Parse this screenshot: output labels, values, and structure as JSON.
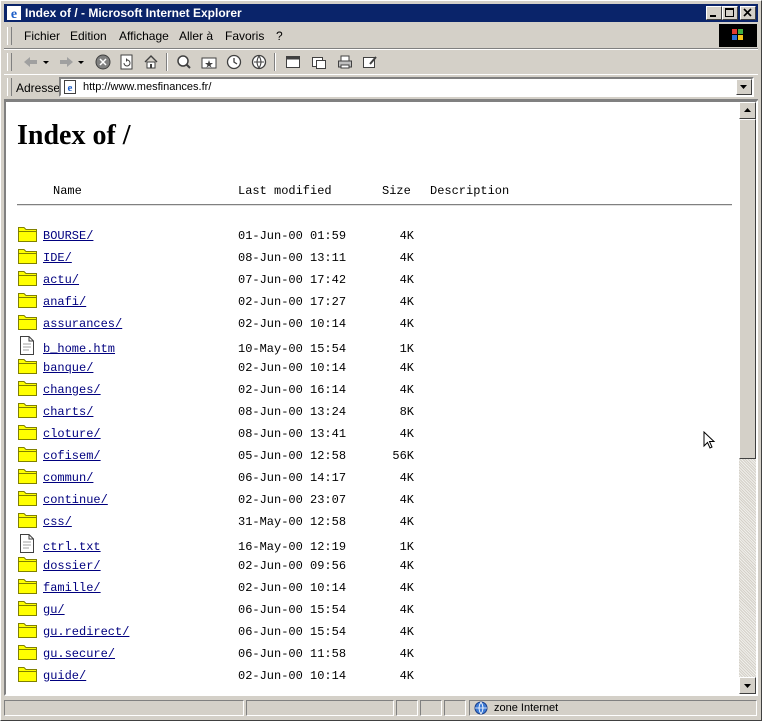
{
  "window": {
    "title": "Index of / - Microsoft Internet Explorer"
  },
  "menu": {
    "items": [
      {
        "label": "Fichier",
        "access": "F"
      },
      {
        "label": "Edition",
        "access": "E"
      },
      {
        "label": "Affichage",
        "access": "A"
      },
      {
        "label": "Aller à",
        "access": "A"
      },
      {
        "label": "Favoris",
        "access": "o"
      },
      {
        "label": "?",
        "access": "?"
      }
    ]
  },
  "toolbar": {
    "buttons": [
      "back-icon",
      "forward-icon",
      "stop-icon",
      "refresh-icon",
      "home-icon",
      "search-icon",
      "favorites-icon",
      "history-icon",
      "channels-icon",
      "fullscreen-icon",
      "mail-icon",
      "print-icon",
      "edit-icon"
    ]
  },
  "address": {
    "label": "Adresse",
    "url": "http://www.mesfinances.fr/"
  },
  "page": {
    "heading": "Index of /",
    "columns": {
      "name": "Name",
      "modified": "Last modified",
      "size": "Size",
      "description": "Description"
    },
    "entries": [
      {
        "name": "BOURSE/",
        "modified": "01-Jun-00 01:59",
        "size": "4K",
        "type": "folder"
      },
      {
        "name": "IDE/",
        "modified": "08-Jun-00 13:11",
        "size": "4K",
        "type": "folder"
      },
      {
        "name": "actu/",
        "modified": "07-Jun-00 17:42",
        "size": "4K",
        "type": "folder"
      },
      {
        "name": "anafi/",
        "modified": "02-Jun-00 17:27",
        "size": "4K",
        "type": "folder"
      },
      {
        "name": "assurances/",
        "modified": "02-Jun-00 10:14",
        "size": "4K",
        "type": "folder"
      },
      {
        "name": "b_home.htm",
        "modified": "10-May-00 15:54",
        "size": "1K",
        "type": "file"
      },
      {
        "name": "banque/",
        "modified": "02-Jun-00 10:14",
        "size": "4K",
        "type": "folder"
      },
      {
        "name": "changes/",
        "modified": "02-Jun-00 16:14",
        "size": "4K",
        "type": "folder"
      },
      {
        "name": "charts/",
        "modified": "08-Jun-00 13:24",
        "size": "8K",
        "type": "folder"
      },
      {
        "name": "cloture/",
        "modified": "08-Jun-00 13:41",
        "size": "4K",
        "type": "folder"
      },
      {
        "name": "cofisem/",
        "modified": "05-Jun-00 12:58",
        "size": "56K",
        "type": "folder"
      },
      {
        "name": "commun/",
        "modified": "06-Jun-00 14:17",
        "size": "4K",
        "type": "folder"
      },
      {
        "name": "continue/",
        "modified": "02-Jun-00 23:07",
        "size": "4K",
        "type": "folder"
      },
      {
        "name": "css/",
        "modified": "31-May-00 12:58",
        "size": "4K",
        "type": "folder"
      },
      {
        "name": "ctrl.txt",
        "modified": "16-May-00 12:19",
        "size": "1K",
        "type": "file"
      },
      {
        "name": "dossier/",
        "modified": "02-Jun-00 09:56",
        "size": "4K",
        "type": "folder"
      },
      {
        "name": "famille/",
        "modified": "02-Jun-00 10:14",
        "size": "4K",
        "type": "folder"
      },
      {
        "name": "gu/",
        "modified": "06-Jun-00 15:54",
        "size": "4K",
        "type": "folder"
      },
      {
        "name": "gu.redirect/",
        "modified": "06-Jun-00 15:54",
        "size": "4K",
        "type": "folder"
      },
      {
        "name": "gu.secure/",
        "modified": "06-Jun-00 11:58",
        "size": "4K",
        "type": "folder"
      },
      {
        "name": "guide/",
        "modified": "02-Jun-00 10:14",
        "size": "4K",
        "type": "folder"
      }
    ]
  },
  "status": {
    "zone": "zone Internet"
  },
  "colors": {
    "titlebar": "#0a246a",
    "link": "#00007f",
    "folder": "#ffff00",
    "chrome": "#d4d0c8"
  }
}
